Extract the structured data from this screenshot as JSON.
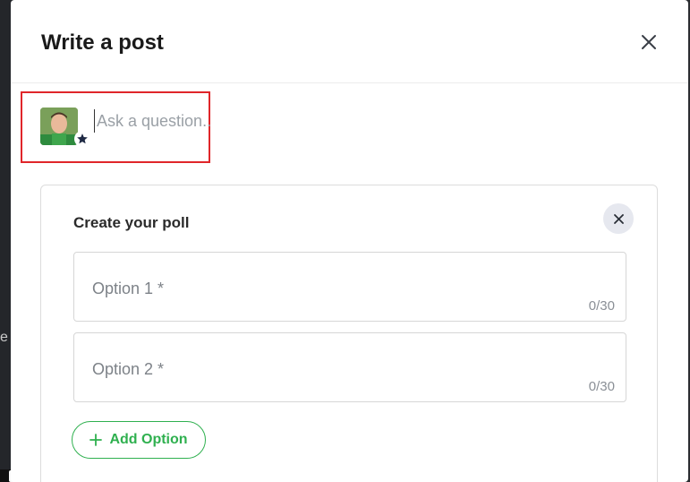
{
  "background": {
    "left_text": "e"
  },
  "modal": {
    "title": "Write a post",
    "close_icon": "close-icon"
  },
  "composer": {
    "avatar_icon": "user-avatar",
    "badge_icon": "star-icon",
    "placeholder": "Ask a question..."
  },
  "poll": {
    "title": "Create your poll",
    "close_icon": "close-icon",
    "options": [
      {
        "placeholder": "Option 1 *",
        "counter": "0/30"
      },
      {
        "placeholder": "Option 2 *",
        "counter": "0/30"
      }
    ],
    "add_option_label": "Add Option",
    "add_option_icon": "plus-icon"
  },
  "colors": {
    "accent_green": "#2fb04f",
    "highlight_red": "#e0262a"
  }
}
